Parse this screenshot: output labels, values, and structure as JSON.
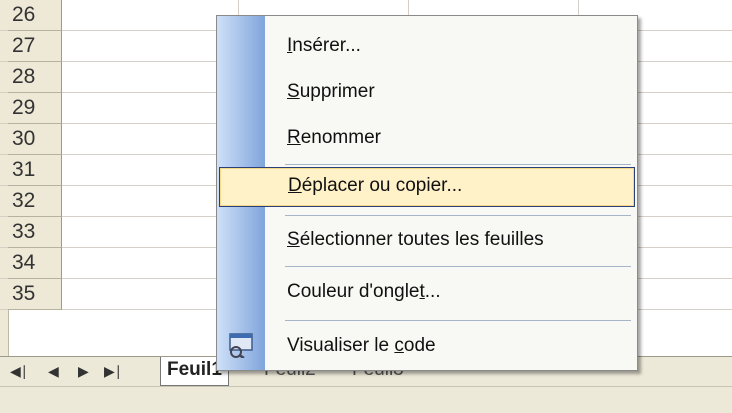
{
  "rows": [
    "26",
    "27",
    "28",
    "29",
    "30",
    "31",
    "32",
    "33",
    "34",
    "35"
  ],
  "menu": {
    "items": [
      {
        "pre": "",
        "ul": "I",
        "post": "nsérer..."
      },
      {
        "pre": "",
        "ul": "S",
        "post": "upprimer"
      },
      {
        "pre": "",
        "ul": "R",
        "post": "enommer"
      },
      {
        "pre": "",
        "ul": "D",
        "post": "éplacer ou copier..."
      },
      {
        "pre": "",
        "ul": "S",
        "post": "électionner toutes les feuilles"
      },
      {
        "pre": "Couleur d'ongle",
        "ul": "t",
        "post": "..."
      },
      {
        "pre": "Visualiser le ",
        "ul": "c",
        "post": "ode"
      }
    ],
    "hover_index": 3,
    "icon": "view-code-icon"
  },
  "tabs": {
    "nav": [
      "first-sheet-icon",
      "prev-sheet-icon",
      "next-sheet-icon",
      "last-sheet-icon"
    ],
    "sheets": [
      {
        "label": "Feuil1",
        "active": true
      },
      {
        "label": "Feuil2",
        "active": false
      },
      {
        "label": "Feuil3",
        "active": false
      }
    ]
  },
  "colors": {
    "hover_bg": "#fff1c8",
    "hover_border": "#2b3f7a",
    "gutter": "#7fa5dc",
    "header": "#ede9d6"
  }
}
